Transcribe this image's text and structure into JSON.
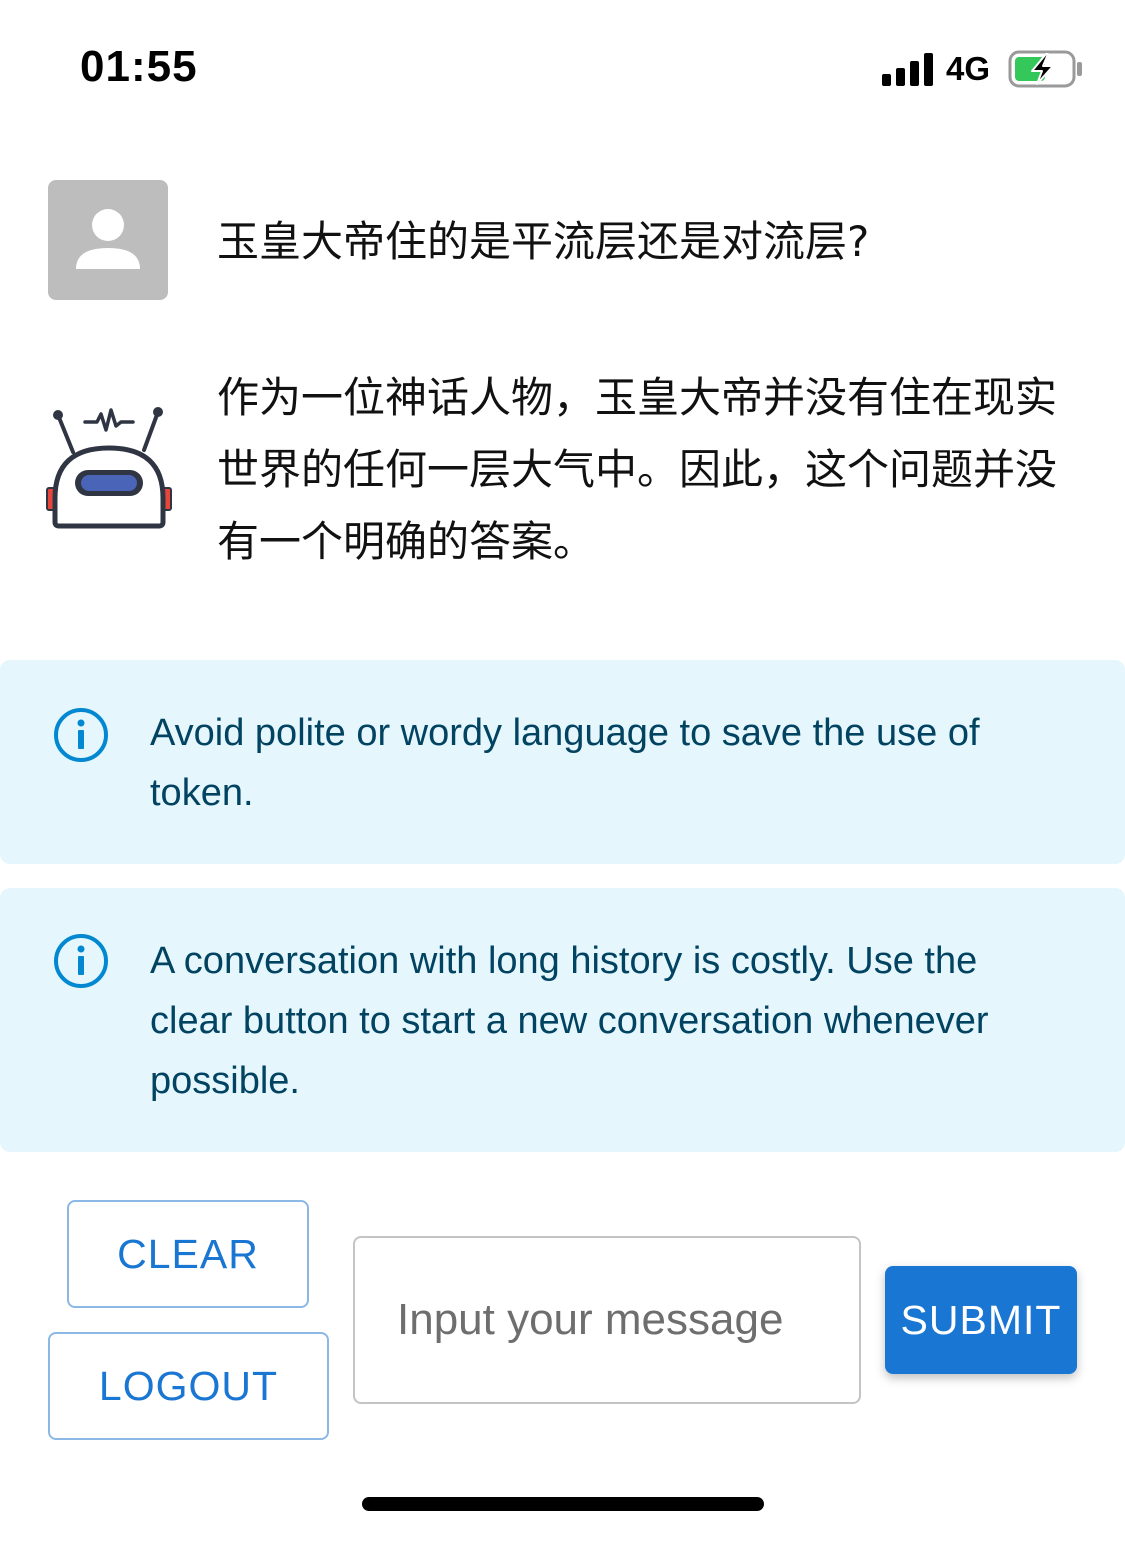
{
  "status_bar": {
    "time": "01:55",
    "network": "4G",
    "battery_charging": true,
    "battery_color": "#34c759"
  },
  "chat": {
    "messages": [
      {
        "role": "user",
        "avatar_icon": "person-icon",
        "text": "玉皇大帝住的是平流层还是对流层?"
      },
      {
        "role": "assistant",
        "avatar_icon": "robot-icon",
        "text": "作为一位神话人物，玉皇大帝并没有住在现实世界的任何一层大气中。因此，这个问题并没有一个明确的答案。"
      }
    ]
  },
  "alerts": [
    {
      "icon": "info-icon",
      "text": "Avoid polite or wordy language to save the use of token."
    },
    {
      "icon": "info-icon",
      "text": "A conversation with long history is costly. Use the clear button to start a new conversation whenever possible."
    }
  ],
  "controls": {
    "clear_label": "CLEAR",
    "logout_label": "LOGOUT",
    "input_placeholder": "Input your message",
    "submit_label": "SUBMIT"
  },
  "colors": {
    "primary": "#1976d2",
    "alert_bg": "#e5f6fd",
    "alert_text": "#014361",
    "info_icon": "#0288d1"
  }
}
